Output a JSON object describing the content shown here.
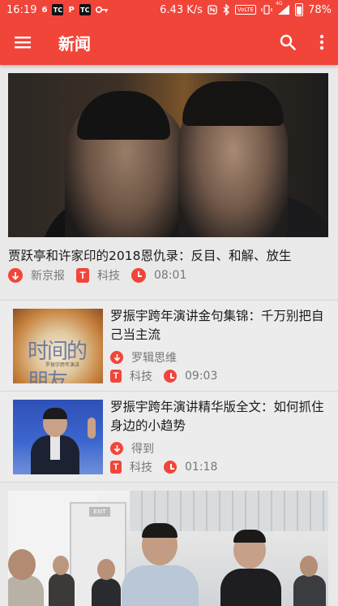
{
  "status_bar": {
    "time": "16:19",
    "app_icons": [
      "6",
      "TC",
      "P",
      "TC",
      "key"
    ],
    "net_speed": "6.43 K/s",
    "volte": "VoLTE",
    "signal_label": "4G",
    "battery": "78%",
    "battery_level": 0.78
  },
  "app_bar": {
    "title": "新闻",
    "menu_icon": "hamburger-menu-icon",
    "search_icon": "search-icon",
    "more_icon": "more-vert-icon"
  },
  "colors": {
    "primary": "#f1453a",
    "background": "#e9e9e9",
    "meta_text": "#777777"
  },
  "articles": [
    {
      "layout": "large",
      "title": "贾跃亭和许家印的2018恩仇录：反目、和解、放生",
      "source": "新京报",
      "category": "科技",
      "time": "08:01"
    },
    {
      "layout": "small",
      "title": "罗振宇跨年演讲金句集锦：千万别把自己当主流",
      "source": "罗辑思维",
      "category": "科技",
      "time": "09:03",
      "thumb_text": "时间的朋友",
      "thumb_subtext": "罗振宇跨年演讲"
    },
    {
      "layout": "small",
      "title": "罗振宇跨年演讲精华版全文：如何抓住身边的小趋势",
      "source": "得到",
      "category": "科技",
      "time": "01:18"
    },
    {
      "layout": "large-photo",
      "photo_sign": "EXIT"
    }
  ],
  "category_badge": "T"
}
